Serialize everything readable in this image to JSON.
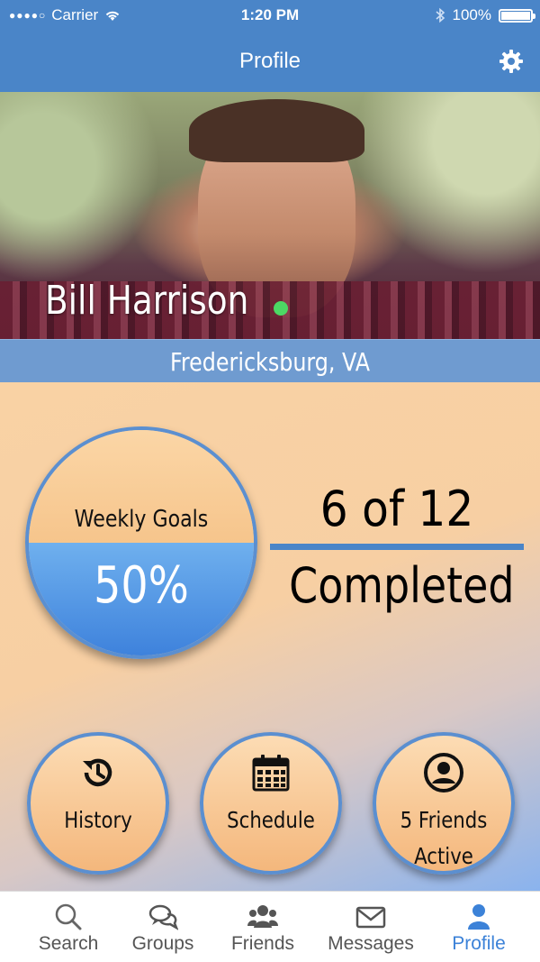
{
  "status_bar": {
    "carrier": "Carrier",
    "time": "1:20 PM",
    "battery": "100%"
  },
  "nav": {
    "title": "Profile"
  },
  "profile": {
    "name": "Bill Harrison",
    "location": "Fredericksburg, VA",
    "online": true
  },
  "goals": {
    "label": "Weekly Goals",
    "percent": "50%",
    "progress": 0.5,
    "ratio_text": "6 of 12",
    "completed_text": "Completed"
  },
  "actions": [
    {
      "label": "History",
      "icon": "history-icon"
    },
    {
      "label": "Schedule",
      "icon": "calendar-icon"
    },
    {
      "label_line1": "5 Friends",
      "label_line2": "Active",
      "icon": "user-icon"
    }
  ],
  "tabs": [
    {
      "label": "Search",
      "icon": "search-icon",
      "active": false
    },
    {
      "label": "Groups",
      "icon": "chat-bubbles-icon",
      "active": false
    },
    {
      "label": "Friends",
      "icon": "group-icon",
      "active": false
    },
    {
      "label": "Messages",
      "icon": "envelope-icon",
      "active": false
    },
    {
      "label": "Profile",
      "icon": "person-icon",
      "active": true
    }
  ],
  "colors": {
    "primary": "#4a85c8",
    "accent_tab": "#3c82d8",
    "online": "#4cd964"
  }
}
